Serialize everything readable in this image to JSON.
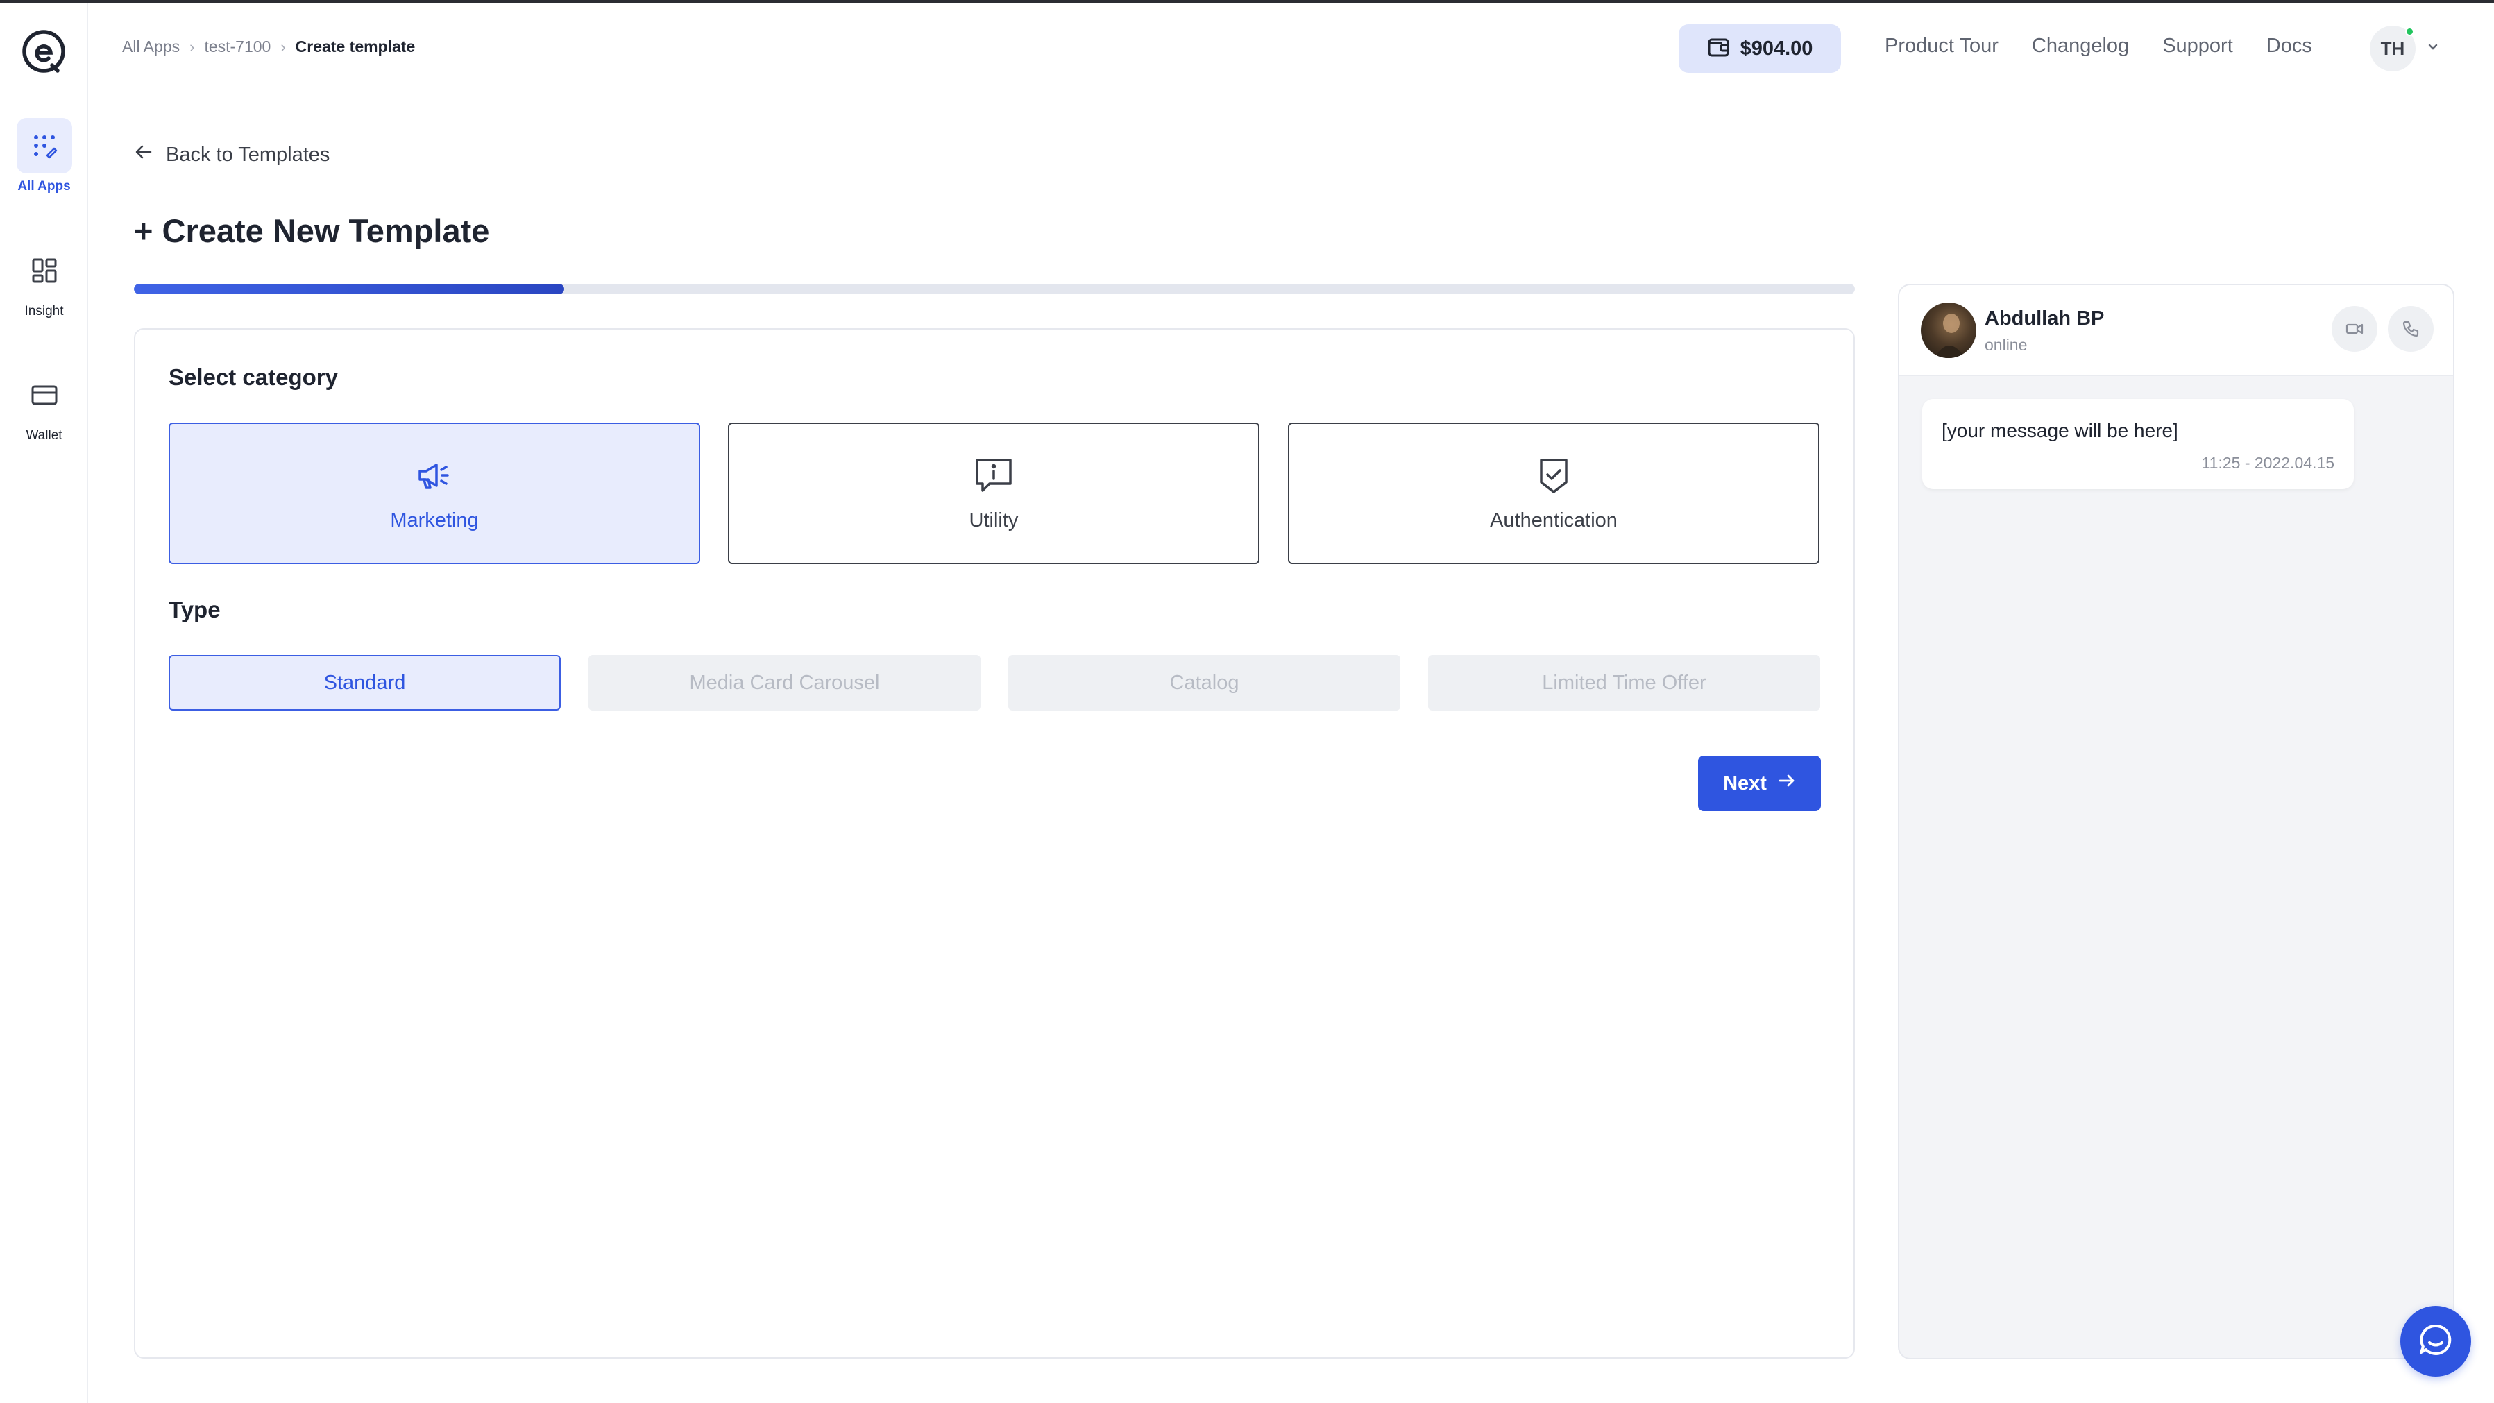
{
  "brand": {
    "accent": "#2f55e0",
    "accent_soft": "#e8ecfd",
    "online": "#22c55e"
  },
  "sidebar": {
    "items": [
      {
        "label": "All Apps",
        "icon": "apps-grid-icon",
        "active": true
      },
      {
        "label": "Insight",
        "icon": "dashboard-icon",
        "active": false
      },
      {
        "label": "Wallet",
        "icon": "card-icon",
        "active": false
      }
    ]
  },
  "header": {
    "breadcrumb": [
      "All Apps",
      "test-7100",
      "Create template"
    ],
    "wallet_amount": "$904.00",
    "links": [
      "Product Tour",
      "Changelog",
      "Support",
      "Docs"
    ],
    "user_initials": "TH"
  },
  "main": {
    "back_label": "Back to Templates",
    "title": "+ Create New Template",
    "progress": 0.25,
    "category_title": "Select category",
    "categories": [
      {
        "label": "Marketing",
        "icon": "megaphone-icon",
        "selected": true
      },
      {
        "label": "Utility",
        "icon": "info-message-icon",
        "selected": false
      },
      {
        "label": "Authentication",
        "icon": "shield-check-icon",
        "selected": false
      }
    ],
    "type_title": "Type",
    "types": [
      {
        "label": "Standard",
        "state": "selected"
      },
      {
        "label": "Media Card Carousel",
        "state": "disabled"
      },
      {
        "label": "Catalog",
        "state": "disabled"
      },
      {
        "label": "Limited Time Offer",
        "state": "disabled"
      }
    ],
    "next_label": "Next"
  },
  "preview": {
    "contact_name": "Abdullah BP",
    "contact_status": "online",
    "message_text": "[your message will be here]",
    "message_time": "11:25 - 2022.04.15"
  }
}
